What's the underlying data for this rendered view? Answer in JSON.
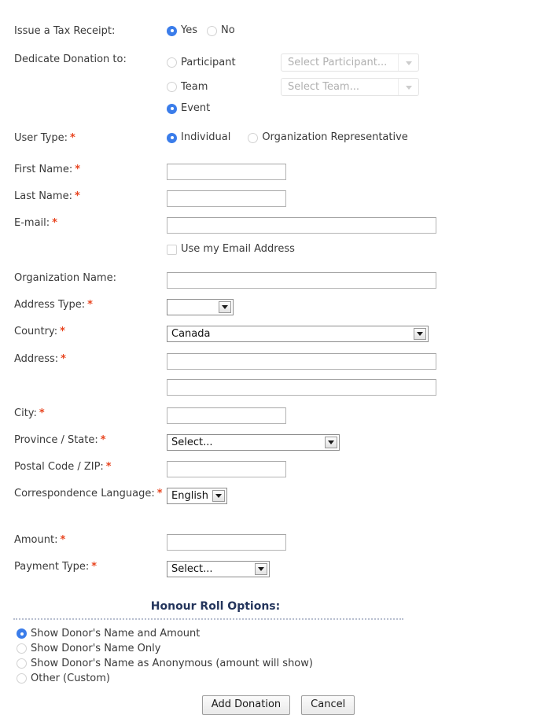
{
  "form": {
    "tax_receipt": {
      "label": "Issue a Tax Receipt:",
      "options": [
        {
          "label": "Yes",
          "selected": true
        },
        {
          "label": "No",
          "selected": false
        }
      ]
    },
    "dedicate": {
      "label": "Dedicate Donation to:",
      "options": [
        {
          "label": "Participant",
          "selected": false
        },
        {
          "label": "Team",
          "selected": false
        },
        {
          "label": "Event",
          "selected": true
        }
      ],
      "participant_select": {
        "value": "Select Participant...",
        "disabled": true
      },
      "team_select": {
        "value": "Select Team...",
        "disabled": true
      }
    },
    "user_type": {
      "label": "User Type:",
      "required": "*",
      "options": [
        {
          "label": "Individual",
          "selected": true
        },
        {
          "label": "Organization Representative",
          "selected": false
        }
      ]
    },
    "first_name": {
      "label": "First Name:",
      "required": "*",
      "value": "",
      "placeholder": ""
    },
    "last_name": {
      "label": "Last Name:",
      "required": "*",
      "value": "",
      "placeholder": ""
    },
    "email": {
      "label": "E-mail:",
      "required": "*",
      "value": "",
      "placeholder": ""
    },
    "use_my_email": {
      "label": "Use my Email Address",
      "checked": false
    },
    "organization_name": {
      "label": "Organization Name:",
      "value": "",
      "placeholder": ""
    },
    "address_type": {
      "label": "Address Type:",
      "required": "*",
      "value": ""
    },
    "country": {
      "label": "Country:",
      "required": "*",
      "value": "Canada"
    },
    "address1": {
      "label": "Address:",
      "required": "*",
      "value": "",
      "placeholder": ""
    },
    "address2": {
      "value": "",
      "placeholder": ""
    },
    "city": {
      "label": "City:",
      "required": "*",
      "value": "",
      "placeholder": ""
    },
    "province": {
      "label": "Province / State:",
      "required": "*",
      "value": "Select..."
    },
    "postal_code": {
      "label": "Postal Code / ZIP:",
      "required": "*",
      "value": "",
      "placeholder": ""
    },
    "language": {
      "label": "Correspondence Language:",
      "required": "*",
      "value": "English"
    },
    "amount": {
      "label": "Amount:",
      "required": "*",
      "value": "",
      "placeholder": ""
    },
    "payment_type": {
      "label": "Payment Type:",
      "required": "*",
      "value": "Select..."
    }
  },
  "honour_roll": {
    "title": "Honour Roll Options:",
    "options": [
      {
        "label": "Show Donor's Name and Amount",
        "selected": true
      },
      {
        "label": "Show Donor's Name Only",
        "selected": false
      },
      {
        "label": "Show Donor's Name as Anonymous (amount will show)",
        "selected": false
      },
      {
        "label": "Other (Custom)",
        "selected": false
      }
    ]
  },
  "actions": {
    "submit": "Add Donation",
    "cancel": "Cancel"
  },
  "colors": {
    "radio_selected": "#3b7dea",
    "required_asterisk": "#e8441f",
    "heading": "#24355c",
    "text": "#3a3a3a"
  }
}
